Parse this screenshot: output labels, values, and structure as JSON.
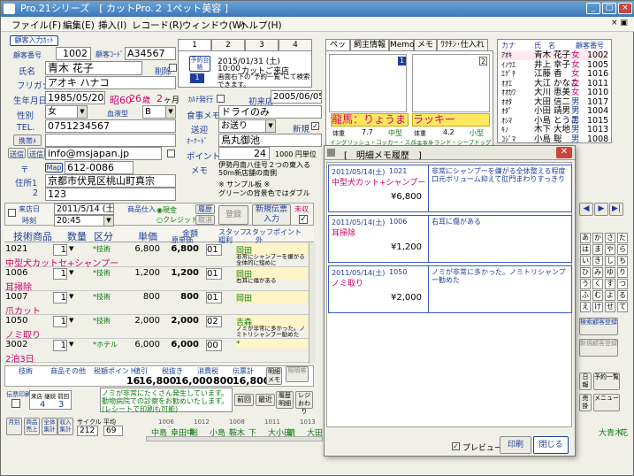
{
  "app": {
    "title": "Pro.21シリーズ　[ カットPro.２ 1ペット美容 ]",
    "win_min": "_",
    "win_max": "□",
    "win_close": "×"
  },
  "menu": [
    "ファイル(F)",
    "編集(E)",
    "挿入(I)",
    "レコード(R)",
    "ウィンドウ(W)",
    "ヘルプ(H)"
  ],
  "menu_close": "× ▣",
  "customer": {
    "register_label": "顧客入力ｶｯﾄ",
    "id_label": "顧客番号",
    "id": "1002",
    "code_label": "顧客ｺｰﾄﾞ",
    "code": "A34567",
    "name_label": "氏名",
    "name": "青木 花子",
    "delete_label": "削除",
    "kana_label": "フリガナ",
    "kana": "アオキ ハナコ",
    "birth_label": "生年月日",
    "birth": "1985/05/20",
    "era": "昭60",
    "age": "26",
    "age_unit": "歳",
    "months": "2",
    "months_unit": "ヶ月",
    "sex_label": "性別",
    "sex": "女",
    "blood_label": "血液型",
    "blood": "B",
    "tel_label": "TEL.",
    "tel": "0751234567",
    "mobile_label": "携帯ﾒ",
    "send_label": "送信",
    "mail_label": "送信",
    "email": "info@msjapan.jp",
    "zip_label": "〒",
    "map_label": "Map",
    "zip": "612-0086",
    "addr1_label": "住所1",
    "addr1": "京都市伏見区桃山町真宗",
    "addr2_label": "2",
    "addr2": "123"
  },
  "reservation": {
    "tabs": [
      "1",
      "2",
      "3",
      "4"
    ],
    "badge": "予約台帳",
    "date": "2015/01/31 (土)",
    "time": "10:00",
    "text": "カットご来店",
    "note": "画面右下の\"予約一覧\"にて検索できます。"
  },
  "pet_info": {
    "karte_label": "ｶﾙﾃ発行",
    "first_visit_label": "初来店",
    "first_visit": "2005/06/05",
    "food_label": "食事メモ",
    "food": "ドライのみ",
    "pickup_label": "送迎",
    "pickup": "お送り",
    "new_label": "新規",
    "owner_label": "ｵｰﾅｰﾄﾞ",
    "owner": "鳥丸御池",
    "point_label": "ポイント",
    "point": "24",
    "point_unit": "1000 円単位",
    "memo_label": "メモ",
    "memo": "伊勢丹南八佳号２つの東入る50m新店舗の南側",
    "memo2": "※ サンプル板 ※",
    "memo3": "グリーンの背景色ではダブル"
  },
  "side_tabs": [
    "ペット",
    "飼主情報",
    "Memo",
    "メモ",
    "ﾜｸﾁﾝ･仕入れ"
  ],
  "pets": [
    {
      "name": "龍馬：りょうま",
      "weight_label": "体重",
      "weight": "7.7",
      "size": "中型",
      "breed": "イングリッシュ・コッカー・スパニエル"
    },
    {
      "name": "ラッキー",
      "weight_label": "体重",
      "weight": "4.2",
      "size": "小型",
      "breed": "シェットランド・シープドッグ"
    }
  ],
  "customer_list": {
    "headers": [
      "カナ",
      "氏　名",
      "顧客番号"
    ],
    "rows": [
      {
        "kana": "ｱｵｷ",
        "name": "青木 花子",
        "sex": "女",
        "no": "1002"
      },
      {
        "kana": "ｲﾉｳｴ",
        "name": "井上 幸子",
        "sex": "女",
        "no": "1005"
      },
      {
        "kana": "ｴｸﾞﾁ",
        "name": "江藤 香",
        "sex": "女",
        "no": "1016"
      },
      {
        "kana": "ｵｵｴ",
        "name": "大江 かなこ",
        "sex": "女",
        "no": "1011"
      },
      {
        "kana": "ｵｵｶﾜ",
        "name": "大川 恵美",
        "sex": "女",
        "no": "1010"
      },
      {
        "kana": "ｵｵﾀ",
        "name": "大田 信二",
        "sex": "男",
        "no": "1017"
      },
      {
        "kana": "ｵﾀﾞ",
        "name": "小田 靖男",
        "sex": "男",
        "no": "1004"
      },
      {
        "kana": "ｵｼﾏ",
        "name": "小島 とうこ",
        "sex": "男",
        "no": "1015"
      },
      {
        "kana": "ｷﾉ",
        "name": "木下 大地",
        "sex": "男",
        "no": "1013"
      },
      {
        "kana": "ｺｼﾞﾏ",
        "name": "小島 聡",
        "sex": "男",
        "no": "1008"
      }
    ]
  },
  "visit": {
    "visit_label": "来店日",
    "date": "2011/5/14 (土)",
    "time_label": "時刻",
    "time": "20:45",
    "goods_label": "商品仕入",
    "cash": "◉現金",
    "credit": "○クレジット",
    "history_label": "履歴",
    "cancel_label": "取消",
    "register_label": "登録",
    "new_btn": "新規伝票入力",
    "unpaid": "未収"
  },
  "items_header": [
    "技術商品",
    "数量",
    "区分",
    "単価",
    "金額",
    "スタッフ",
    "スタッフポイント",
    "原単価",
    "粗利",
    "外"
  ],
  "items": [
    {
      "code": "1021",
      "name": "中型犬カットセ+シャンプー",
      "qty": "1",
      "cls": "*技術",
      "price": "6,800",
      "amount": "6,800",
      "cost": "",
      "staff": "01",
      "staff_name": "岡田",
      "note": "非常にシャンプーを嫌がる全体的に短めに"
    },
    {
      "code": "1006",
      "name": "耳掃除",
      "qty": "1",
      "cls": "*技術",
      "price": "1,200",
      "amount": "1,200",
      "cost": "",
      "staff": "01",
      "staff_name": "岡田",
      "note": "右耳に傷がある"
    },
    {
      "code": "1007",
      "name": "爪カット",
      "qty": "1",
      "cls": "*技術",
      "price": "800",
      "amount": "800",
      "cost": "",
      "staff": "01",
      "staff_name": "岡田",
      "note": ""
    },
    {
      "code": "1050",
      "name": "ノミ取り",
      "qty": "1",
      "cls": "*技術",
      "price": "2,000",
      "amount": "2,000",
      "cost": "",
      "staff": "02",
      "staff_name": "吉森",
      "note": "ノミが非常に多かった。ノミトリシャンプー勧めた"
    },
    {
      "code": "3002",
      "name": "2泊3日",
      "qty": "1",
      "cls": "*ホテル",
      "price": "6,000",
      "amount": "6,000",
      "cost": "",
      "staff": "00",
      "staff_name": "*",
      "note": ""
    }
  ],
  "totals": {
    "headers": [
      "技術",
      "商品その他",
      "税額ポイント",
      "値引",
      "税抜き",
      "消費税",
      "伝票計"
    ],
    "values": [
      "16",
      "16,800",
      "16,000",
      "800",
      "16,800"
    ],
    "detail_label": "明細",
    "detail_sub": "メモ"
  },
  "footer": {
    "cards": [
      "伝票印刷",
      "来店 継続 前回",
      "4",
      "3"
    ],
    "message": "ノミが非常にたくさん発生しています。動物病院での診察をお勧めいたします。(レシートで印刷も可能)",
    "btns": [
      "前回",
      "最近",
      "履歴明細",
      "レジおわり",
      "照明帯"
    ],
    "bottom_btns": [
      "月別",
      "商品売上",
      "全体集計",
      "収入集計"
    ],
    "cycle_label": "サイクル",
    "cycle": "212",
    "lang_label": "平均",
    "lang": "69",
    "names": [
      "中島",
      "幸田中",
      "聡",
      "小島",
      "鞍木",
      "下",
      "大小田",
      "靖",
      "大田"
    ],
    "bottom_right": [
      "大青木",
      "花"
    ],
    "numbers": [
      "1006",
      "1012",
      "1008",
      "1011",
      "1013"
    ]
  },
  "right_panel": {
    "kana_buttons": [
      "あ",
      "か",
      "さ",
      "た",
      "な",
      "は",
      "ま",
      "や",
      "ら",
      "わ",
      "い",
      "き",
      "し",
      "ち",
      "に",
      "ひ",
      "み",
      "ゆ",
      "り",
      "を",
      "う",
      "く",
      "す",
      "つ",
      "ぬ",
      "ふ",
      "む",
      "よ",
      "る",
      "ん",
      "え",
      "け",
      "せ",
      "て",
      "ね"
    ],
    "nav": [
      "◀",
      "▶",
      "▶|"
    ],
    "btn1": "検索顧客登録",
    "btn2": "新規顧客登録",
    "btn3": "日報",
    "btn4": "予約一覧",
    "btn5": "売掛",
    "btn6": "メニュー"
  },
  "modal": {
    "title": "[　明細メモ履歴　]",
    "entries": [
      {
        "date": "2011/05/14(土)",
        "code": "1021",
        "item": "中型犬カット+シャンプー",
        "amount": "¥6,800",
        "memo": "非常にシャンプーを嫌がる全体整える程度口元ボリューム抑えて肛門まわりすっきり"
      },
      {
        "date": "2011/05/14(土)",
        "code": "1006",
        "item": "耳掃除",
        "amount": "¥1,200",
        "memo": "右耳に傷がある"
      },
      {
        "date": "2011/05/14(土)",
        "code": "1050",
        "item": "ノミ取り",
        "amount": "¥2,000",
        "memo": "ノミが非常に多かった。ノミトリシャンプー勧めた"
      }
    ],
    "preview_label": "プレビュー",
    "print_label": "印刷",
    "close_label": "閉じる"
  }
}
